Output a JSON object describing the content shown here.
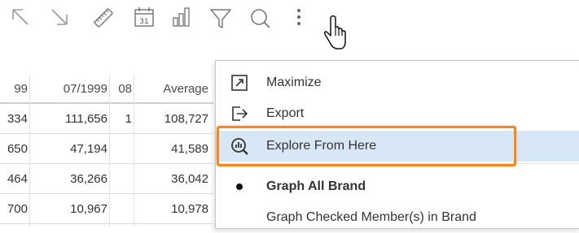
{
  "toolbar": {
    "icons": [
      "expand-arrow-icon",
      "collapse-arrow-icon",
      "ruler-icon",
      "calendar-icon",
      "bar-chart-icon",
      "filter-icon",
      "search-icon",
      "more-vertical-icon"
    ],
    "calendar_day": "31"
  },
  "table": {
    "headers": [
      "99",
      "07/1999",
      "08",
      "Average"
    ],
    "rows": [
      [
        "334",
        "111,656",
        "1",
        "108,727"
      ],
      [
        "650",
        "47,194",
        "",
        "41,589"
      ],
      [
        "464",
        "36,266",
        "",
        "36,042"
      ],
      [
        "700",
        "10,967",
        "",
        "10,978"
      ]
    ]
  },
  "menu": {
    "items": [
      {
        "label": "Maximize",
        "icon": "maximize-icon"
      },
      {
        "label": "Export",
        "icon": "export-icon"
      },
      {
        "label": "Explore From Here",
        "icon": "explore-icon",
        "highlighted": true
      },
      {
        "label": "Graph All Brand",
        "icon": "bullet-icon",
        "selected": true
      },
      {
        "label": "Graph Checked Member(s) in Brand",
        "icon": ""
      }
    ]
  },
  "colors": {
    "highlight": "#d8e7f5",
    "focus_outline": "#f08a24",
    "icon_gray": "#8a8a8a"
  }
}
